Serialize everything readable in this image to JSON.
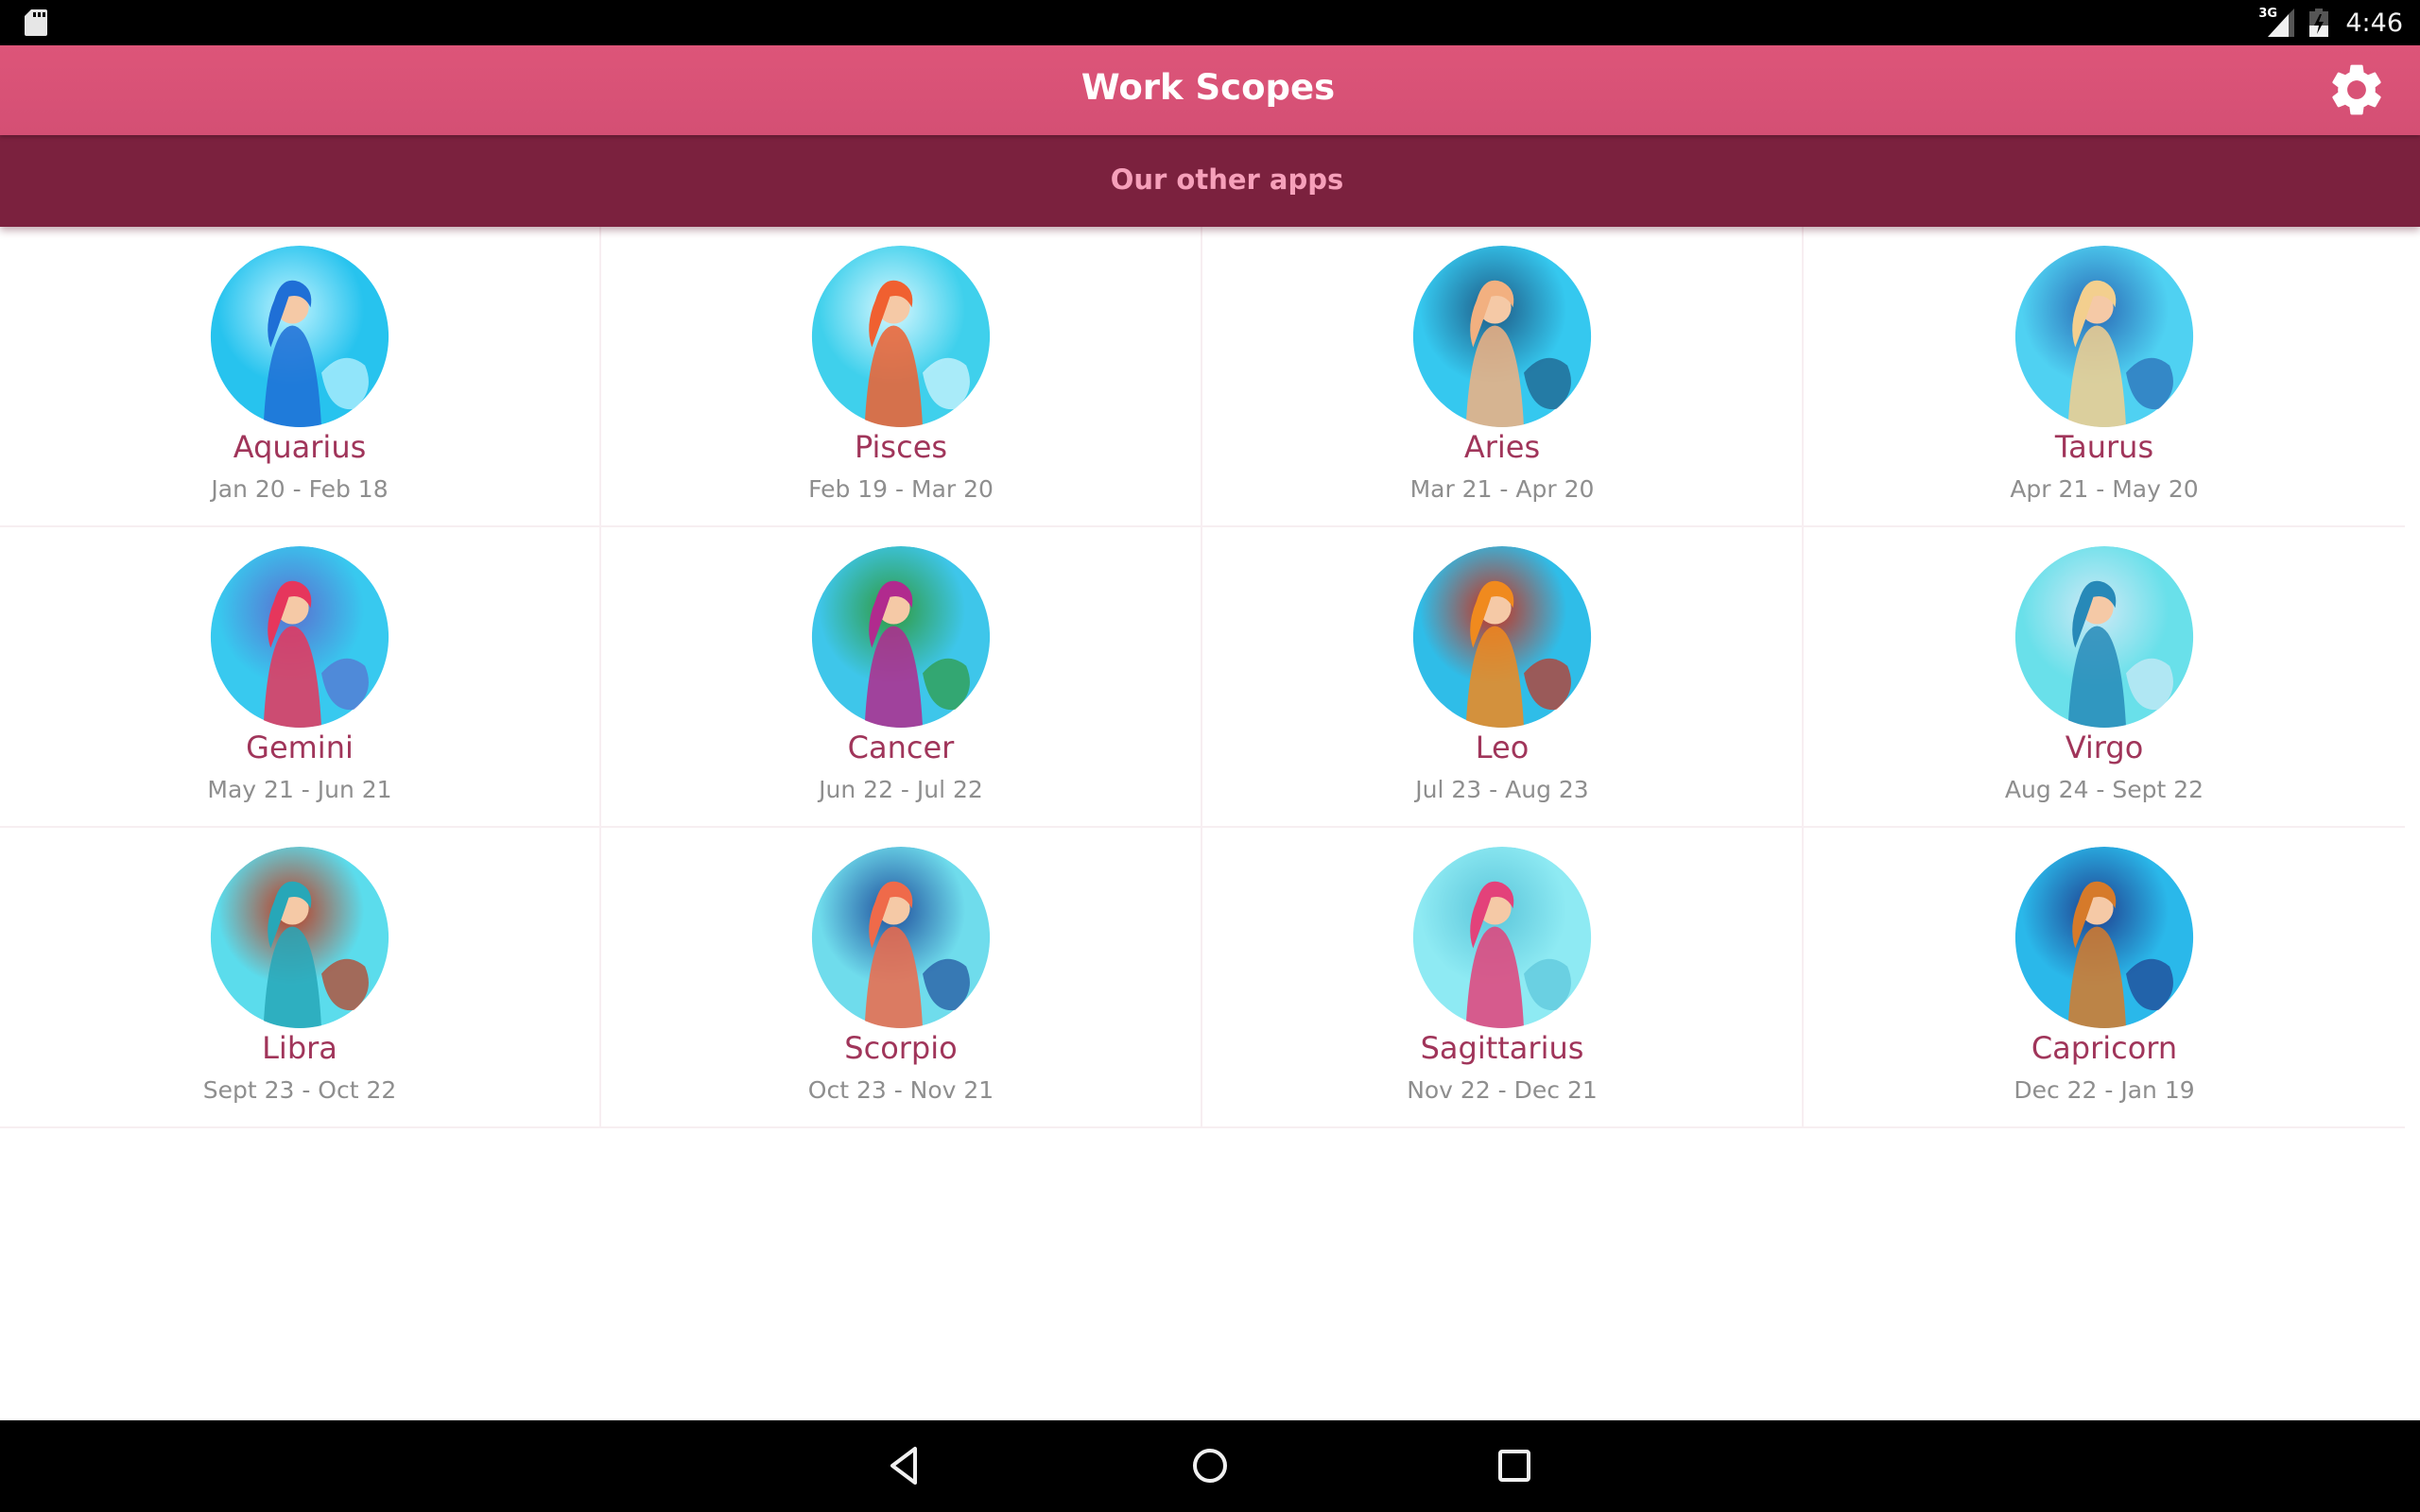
{
  "status_bar": {
    "left_icons": [
      "sd-card-icon"
    ],
    "network_label": "3G",
    "right_icons": [
      "signal-icon",
      "battery-charging-icon"
    ],
    "time": "4:46"
  },
  "toolbar": {
    "title": "Work Scopes",
    "settings_icon": "gear-icon"
  },
  "banner": {
    "label": "Our other apps"
  },
  "colors": {
    "toolbar": "#D9527A",
    "banner": "#7B213E",
    "banner_text": "#F6A0BA",
    "sign_name": "#A0355A",
    "sign_dates": "#8E8E8E"
  },
  "signs": [
    {
      "name": "Aquarius",
      "dates": "Jan 20 - Feb 18",
      "image": "aquarius-illustration",
      "palette": [
        "#27c3ee",
        "#1f6fd6",
        "#bff3ff"
      ]
    },
    {
      "name": "Pisces",
      "dates": "Feb 19 - Mar 20",
      "image": "pisces-illustration",
      "palette": [
        "#3fd0ec",
        "#f06030",
        "#d7f7ff"
      ]
    },
    {
      "name": "Aries",
      "dates": "Mar 21 - Apr 20",
      "image": "aries-illustration",
      "palette": [
        "#35c8ef",
        "#f2b080",
        "#1e5a86"
      ]
    },
    {
      "name": "Taurus",
      "dates": "Apr 21 - May 20",
      "image": "taurus-illustration",
      "palette": [
        "#4fd1f2",
        "#f3cf8e",
        "#2a69b5"
      ]
    },
    {
      "name": "Gemini",
      "dates": "May 21 - Jun 21",
      "image": "gemini-illustration",
      "palette": [
        "#38c9ef",
        "#e6365c",
        "#5a6fd0"
      ]
    },
    {
      "name": "Cancer",
      "dates": "Jun 22 - Jul 22",
      "image": "cancer-illustration",
      "palette": [
        "#3ec6ea",
        "#b12a8e",
        "#2f9a3e"
      ]
    },
    {
      "name": "Leo",
      "dates": "Jul 23 - Aug 23",
      "image": "leo-illustration",
      "palette": [
        "#2fbde8",
        "#f08a1e",
        "#c8301c"
      ]
    },
    {
      "name": "Virgo",
      "dates": "Aug 24 - Sept 22",
      "image": "virgo-illustration",
      "palette": [
        "#69e0ea",
        "#2789b8",
        "#cfe9f6"
      ]
    },
    {
      "name": "Libra",
      "dates": "Sept 23 - Oct 22",
      "image": "libra-illustration",
      "palette": [
        "#5bdcec",
        "#27a7b8",
        "#c0391d"
      ]
    },
    {
      "name": "Scorpio",
      "dates": "Oct 23 - Nov 21",
      "image": "scorpio-illustration",
      "palette": [
        "#6fdcec",
        "#ef6a4a",
        "#1f4f9d"
      ]
    },
    {
      "name": "Sagittarius",
      "dates": "Nov 22 - Dec 21",
      "image": "sagittarius-illustration",
      "palette": [
        "#8eeaf3",
        "#e3427a",
        "#5bc5da"
      ]
    },
    {
      "name": "Capricorn",
      "dates": "Dec 22 - Jan 19",
      "image": "capricorn-illustration",
      "palette": [
        "#2ab8ea",
        "#d67a2a",
        "#1f3f8f"
      ]
    }
  ],
  "nav_bar": {
    "buttons": [
      "back-icon",
      "home-icon",
      "recents-icon"
    ]
  }
}
